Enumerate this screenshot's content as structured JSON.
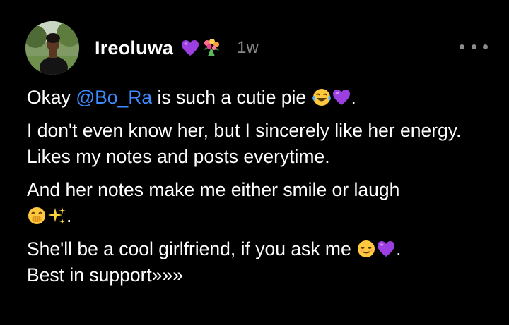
{
  "post": {
    "author": {
      "name": "Ireoluwa",
      "badges": [
        "purple-heart-icon",
        "bouquet-icon"
      ]
    },
    "timestamp": "1w",
    "more_label": "more-options",
    "paragraphs": [
      {
        "before": "Okay ",
        "mention": "@Bo_Ra",
        "after": " is such a cutie pie ",
        "emojis": [
          "tears-of-joy-icon",
          "purple-heart-icon"
        ],
        "end": "."
      },
      {
        "text": "I don't even know her, but I sincerely like her energy. Likes my notes and posts everytime."
      },
      {
        "text": "And her notes make me either smile or laugh ",
        "emojis": [
          "hand-over-mouth-icon",
          "sparkles-icon"
        ],
        "end": "."
      },
      {
        "text": "She'll be a cool girlfriend, if you ask me ",
        "emojis": [
          "relieved-face-icon",
          "purple-heart-icon"
        ],
        "end": ".",
        "line2": "Best in support»»»"
      }
    ]
  },
  "colors": {
    "background": "#000000",
    "text": "#ffffff",
    "muted": "#8a8a8a",
    "mention": "#3d8bff",
    "heart": "#9b3fe0"
  }
}
